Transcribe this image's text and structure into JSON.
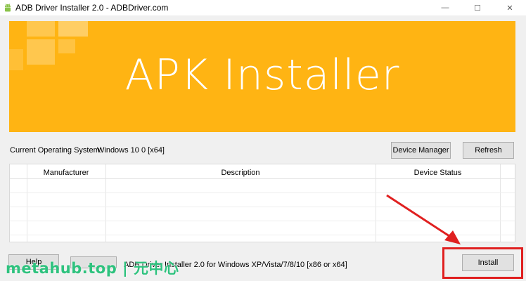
{
  "window": {
    "title": "ADB Driver Installer 2.0 - ADBDriver.com",
    "controls": {
      "minimize": "—",
      "maximize": "☐",
      "close": "✕"
    }
  },
  "banner": {
    "title": "APK Installer",
    "color": "#ffb413"
  },
  "system": {
    "label": "Current Operating System:",
    "value": "Windows 10 0 [x64]"
  },
  "buttons": {
    "device_manager": "Device Manager",
    "refresh": "Refresh",
    "help": "Help",
    "install": "Install"
  },
  "table": {
    "columns": [
      "Manufacturer",
      "Description",
      "Device Status"
    ],
    "rows": []
  },
  "status": {
    "text": "ADB Driver Installer 2.0 for Windows XP/Vista/7/8/10 [x86 or x64]"
  },
  "watermark": {
    "text": "metahub.top | 元中心"
  },
  "annotation": {
    "color": "#e02020"
  }
}
